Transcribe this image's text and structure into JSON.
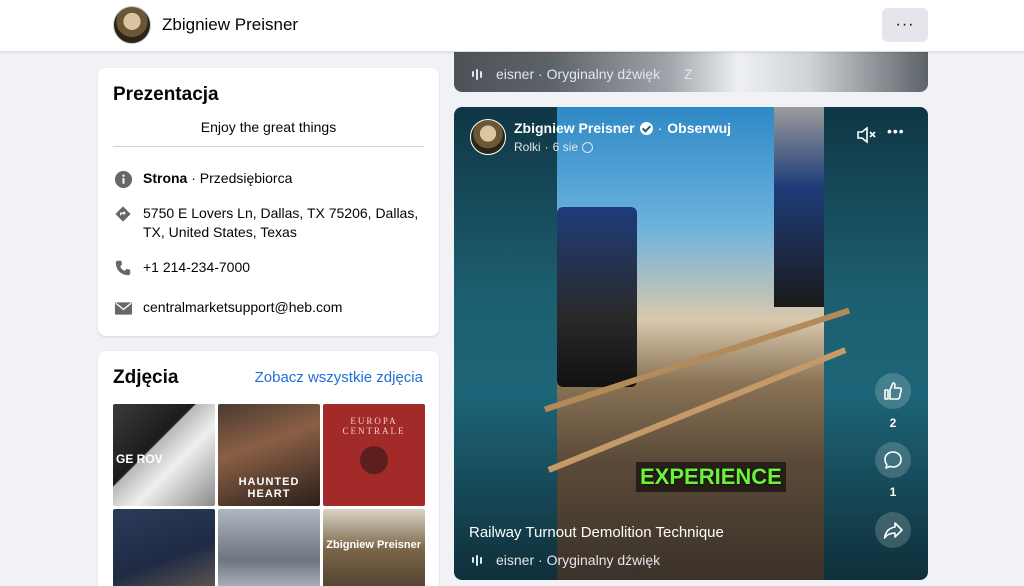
{
  "header": {
    "page_name": "Zbigniew Preisner",
    "more_label": "···"
  },
  "intro": {
    "title": "Prezentacja",
    "bio": "Enjoy the great things",
    "category_strong": "Strona",
    "category_rest": " · Przedsiębiorca",
    "address": "5750 E Lovers Ln, Dallas, TX 75206, Dallas, TX, United States, Texas",
    "phone": "+1 214-234-7000",
    "email": "centralmarketsupport@heb.com"
  },
  "photos": {
    "title": "Zdjęcia",
    "see_all": "Zobacz wszystkie zdjęcia",
    "captions": [
      "GE ROV",
      "HAUNTED HEART",
      "EUROPA CENTRALE",
      "",
      "",
      "Zbigniew Preisner"
    ]
  },
  "post_top": {
    "audio": "eisner · Oryginalny dźwięk",
    "audio_suffix": "Z"
  },
  "reel": {
    "author": "Zbigniew Preisner",
    "follow": "Obserwuj",
    "section": "Rolki",
    "date": "6 sie",
    "caption_word": "EXPERIENCE",
    "likes": "2",
    "comments": "1",
    "title": "Railway Turnout Demolition Technique",
    "audio": "eisner · Oryginalny dźwięk"
  },
  "icons": {
    "info": "info-icon",
    "category": "diamond-arrow-icon",
    "phone": "phone-icon",
    "email": "envelope-icon",
    "like": "thumbs-up-icon",
    "comment": "comment-icon",
    "share": "share-icon",
    "mute": "speaker-muted-icon",
    "globe": "globe-icon",
    "verified": "verified-badge-icon"
  }
}
